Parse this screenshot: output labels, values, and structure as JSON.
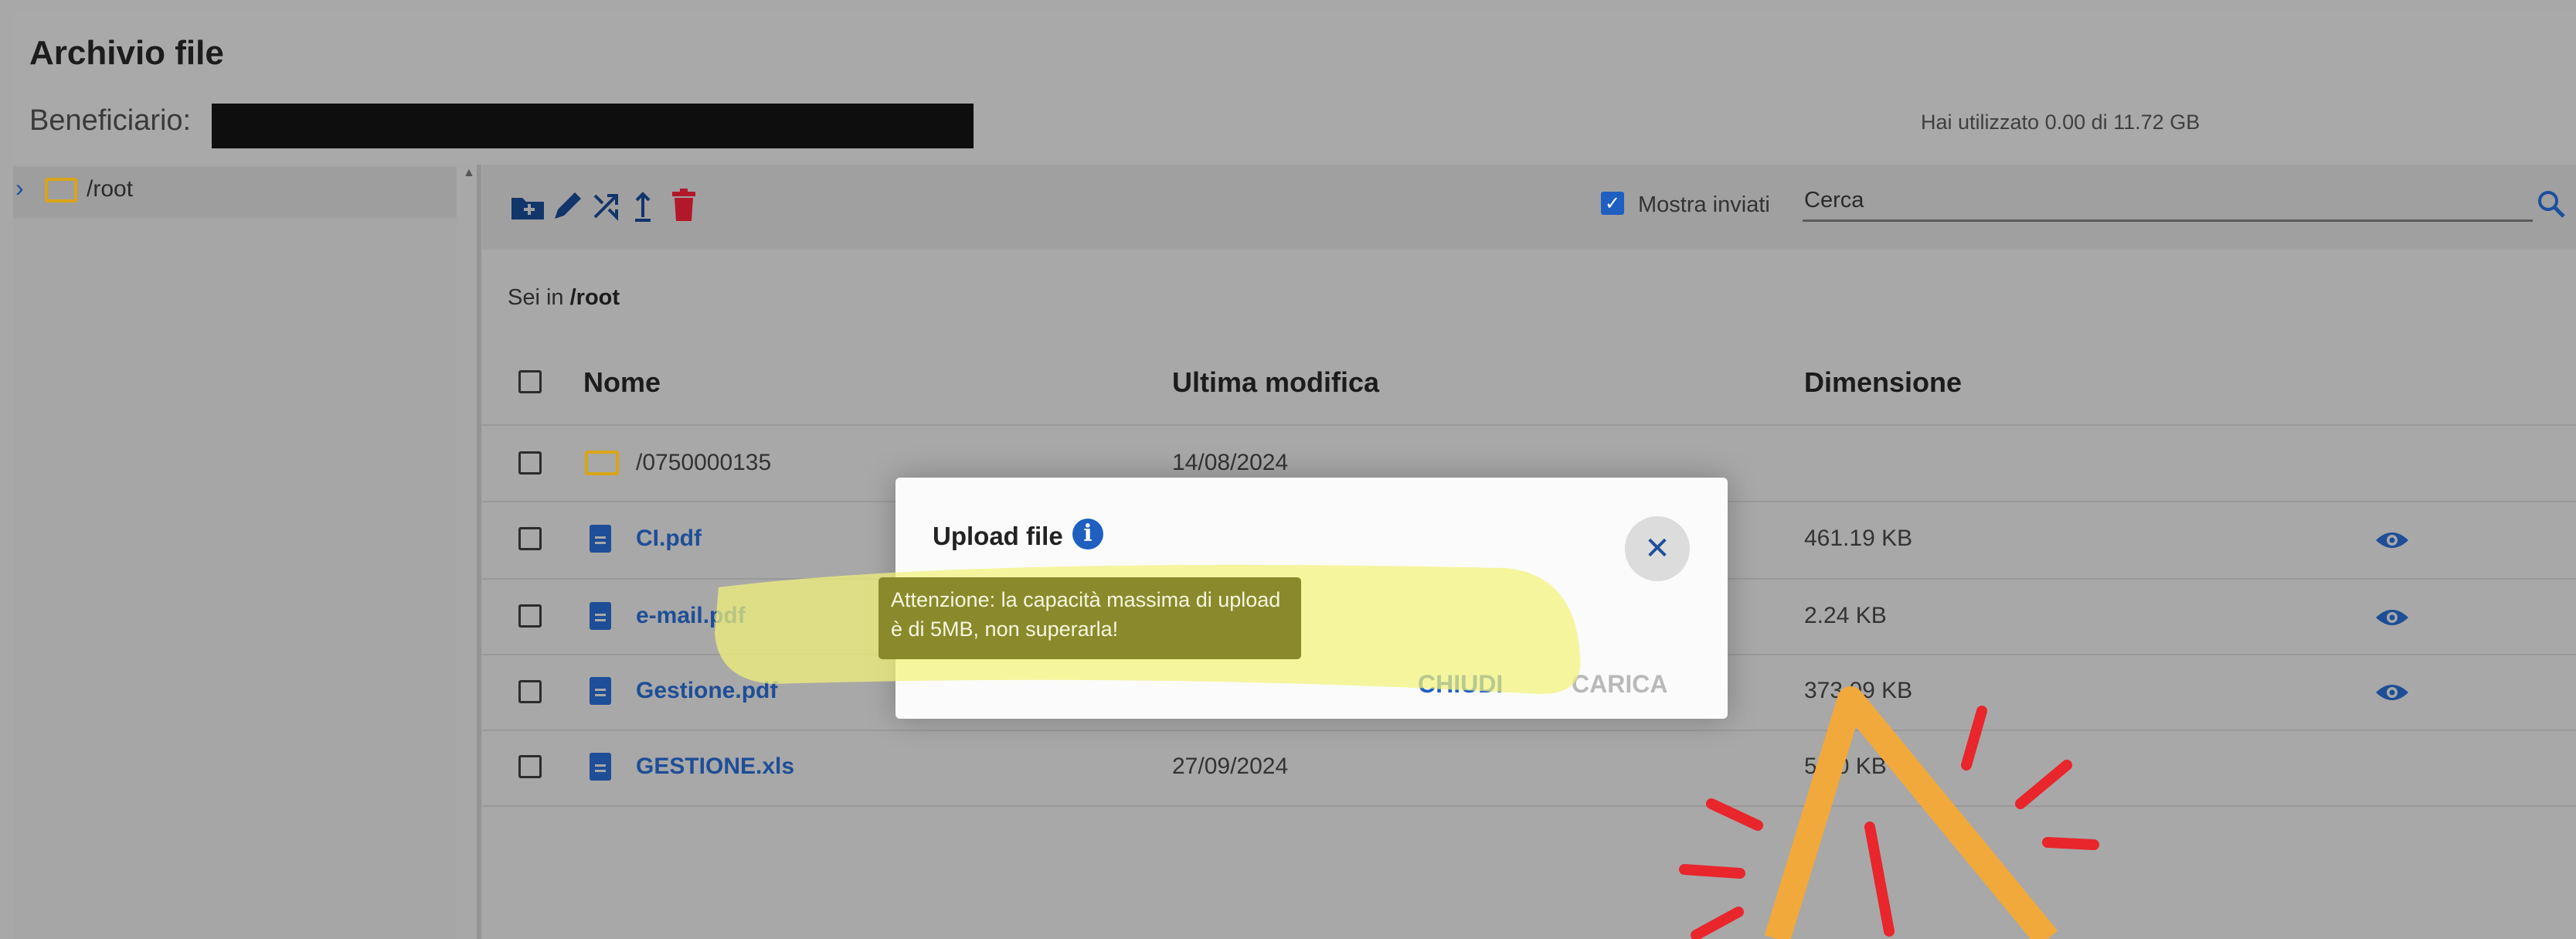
{
  "header": {
    "title": "Archivio file",
    "beneficiary_label": "Beneficiario:",
    "storage_usage": "Hai utilizzato 0.00 di 11.72 GB"
  },
  "sidebar": {
    "tree_root_label": "/root"
  },
  "toolbar": {
    "icons": [
      "new-folder-icon",
      "edit-icon",
      "move-icon",
      "upload-icon",
      "delete-icon"
    ],
    "show_sent_label": "Mostra inviati",
    "show_sent_checked": true,
    "search_value": "Cerca"
  },
  "breadcrumb": {
    "prefix": "Sei in",
    "path": "/root"
  },
  "table": {
    "headers": [
      "Nome",
      "Ultima modifica",
      "Dimensione"
    ],
    "rows": [
      {
        "name": "/0750000135",
        "type": "folder",
        "modified": "14/08/2024",
        "size": ""
      },
      {
        "name": "CI.pdf",
        "type": "file",
        "modified": "",
        "size": "461.19 KB"
      },
      {
        "name": "e-mail.pdf",
        "type": "file",
        "modified": "",
        "size": "2.24 KB"
      },
      {
        "name": "Gestione.pdf",
        "type": "file",
        "modified": "",
        "size": "373.09 KB"
      },
      {
        "name": "GESTIONE.xls",
        "type": "file",
        "modified": "27/09/2024",
        "size": "5 50 KB"
      }
    ]
  },
  "modal": {
    "title": "Upload file",
    "tooltip": "Attenzione: la capacità massima di upload è di 5MB, non superarla!",
    "close_label": "CHIUDI",
    "upload_label": "CARICA"
  },
  "colors": {
    "accent": "#1f5fc0",
    "link": "#1e4e97",
    "folder": "#d9a418",
    "delete": "#b3182a",
    "highlight": "#f2f27a",
    "arrow": "#f2a93b",
    "burst": "#e8262c"
  }
}
